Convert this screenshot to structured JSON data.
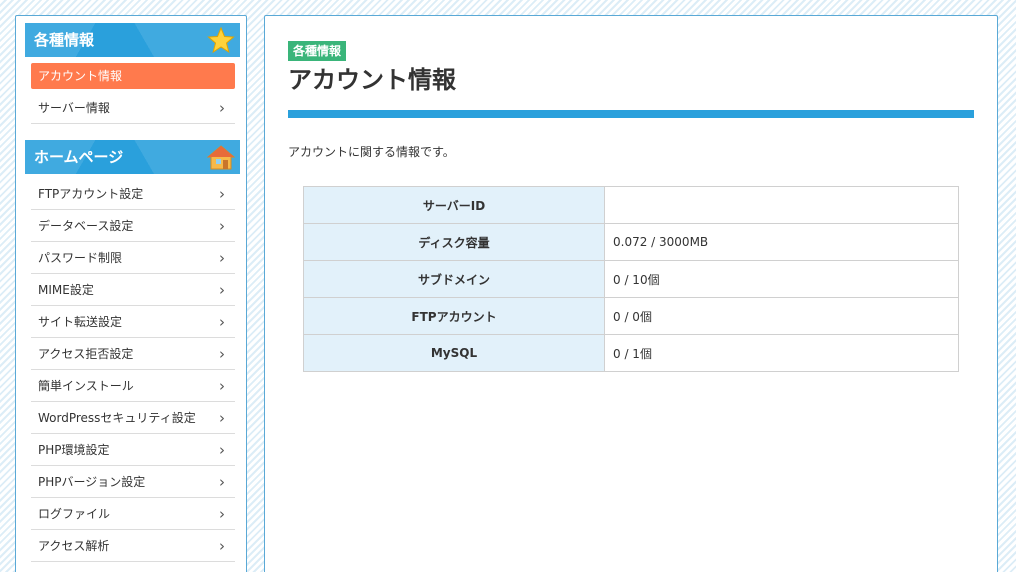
{
  "sidebar": {
    "section1": {
      "title": "各種情報",
      "icon": "star-icon",
      "active_item": "アカウント情報",
      "items": [
        {
          "label": "サーバー情報"
        }
      ]
    },
    "section2": {
      "title": "ホームページ",
      "icon": "home-icon",
      "items": [
        {
          "label": "FTPアカウント設定"
        },
        {
          "label": "データベース設定"
        },
        {
          "label": "パスワード制限"
        },
        {
          "label": "MIME設定"
        },
        {
          "label": "サイト転送設定"
        },
        {
          "label": "アクセス拒否設定"
        },
        {
          "label": "簡単インストール"
        },
        {
          "label": "WordPressセキュリティ設定"
        },
        {
          "label": "PHP環境設定"
        },
        {
          "label": "PHPバージョン設定"
        },
        {
          "label": "ログファイル"
        },
        {
          "label": "アクセス解析"
        }
      ]
    }
  },
  "main": {
    "badge": "各種情報",
    "title": "アカウント情報",
    "description": "アカウントに関する情報です。",
    "table": [
      {
        "key": "サーバーID",
        "value": ""
      },
      {
        "key": "ディスク容量",
        "value": "0.072 / 3000MB"
      },
      {
        "key": "サブドメイン",
        "value": "0 / 10個"
      },
      {
        "key": "FTPアカウント",
        "value": "0 / 0個"
      },
      {
        "key": "MySQL",
        "value": "0 / 1個"
      }
    ]
  },
  "colors": {
    "accent_blue": "#2aa0dc",
    "active_orange": "#ff7a4d",
    "badge_green": "#3ab57a",
    "table_key_bg": "#e2f1fa"
  }
}
